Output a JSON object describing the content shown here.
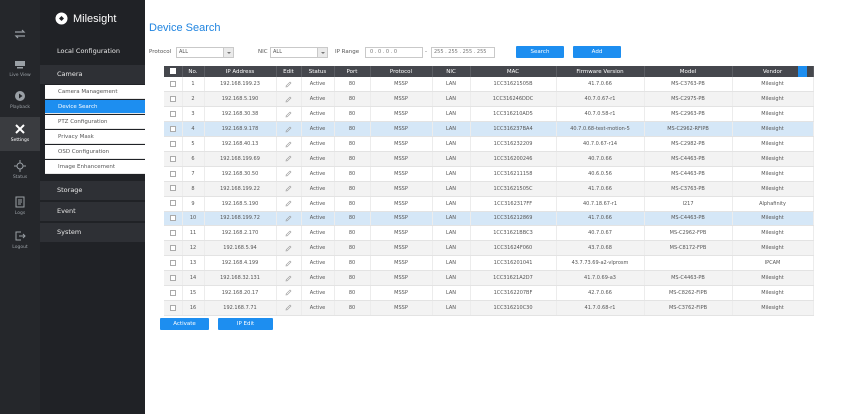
{
  "rail": [
    {
      "name": "live-view",
      "label": "Live View"
    },
    {
      "name": "playback",
      "label": "Playback"
    },
    {
      "name": "settings",
      "label": "Settings"
    },
    {
      "name": "status",
      "label": "Status"
    },
    {
      "name": "logs",
      "label": "Logs"
    },
    {
      "name": "logout",
      "label": "Logout"
    }
  ],
  "brand": "Milesight",
  "menu": {
    "local_configuration": "Local Configuration",
    "camera": "Camera",
    "sub_items": [
      "Camera Management",
      "Device Search",
      "PTZ Configuration",
      "Privacy Mask",
      "OSD Configuration",
      "Image Enhancement"
    ],
    "storage": "Storage",
    "event": "Event",
    "system": "System"
  },
  "page": {
    "title": "Device Search",
    "protocol_label": "Protocol",
    "protocol_value": "ALL",
    "nic_label": "NIC",
    "nic_value": "ALL",
    "ip_range_label": "IP Range",
    "ip_start": "0 . 0 . 0 . 0",
    "ip_end": "255 . 255 . 255 . 255",
    "search_button": "Search",
    "add_button": "Add",
    "activate_button": "Activate",
    "ip_edit_button": "IP Edit"
  },
  "table": {
    "headers": [
      "No.",
      "IP Address",
      "Edit",
      "Status",
      "Port",
      "Protocol",
      "NIC",
      "MAC",
      "Firmware Version",
      "Model",
      "Vendor"
    ],
    "rows": [
      [
        "1",
        "192.168.199.23",
        "Active",
        "80",
        "MSSP",
        "LAN",
        "1CC31621505B",
        "41.7.0.66",
        "MS-C3763-PB",
        "Milesight"
      ],
      [
        "2",
        "192.168.5.190",
        "Active",
        "80",
        "MSSP",
        "LAN",
        "1CC316246DDC",
        "40.7.0.67-r1",
        "MS-C2975-PB",
        "Milesight"
      ],
      [
        "3",
        "192.168.30.38",
        "Active",
        "80",
        "MSSP",
        "LAN",
        "1CC316210AD5",
        "40.7.0.58-r1",
        "MS-C2963-PB",
        "Milesight"
      ],
      [
        "4",
        "192.168.9.178",
        "Active",
        "80",
        "MSSP",
        "LAN",
        "1CC316237BA4",
        "40.7.0.68-test-motion-5",
        "MS-C2962-RFIPB",
        "Milesight"
      ],
      [
        "5",
        "192.168.40.13",
        "Active",
        "80",
        "MSSP",
        "LAN",
        "1CC316232209",
        "40.7.0.67-r14",
        "MS-C2982-PB",
        "Milesight"
      ],
      [
        "6",
        "192.168.199.69",
        "Active",
        "80",
        "MSSP",
        "LAN",
        "1CC316200246",
        "40.7.0.66",
        "MS-C4463-PB",
        "Milesight"
      ],
      [
        "7",
        "192.168.30.50",
        "Active",
        "80",
        "MSSP",
        "LAN",
        "1CC316211158",
        "40.6.0.56",
        "MS-C4463-PB",
        "Milesight"
      ],
      [
        "8",
        "192.168.199.22",
        "Active",
        "80",
        "MSSP",
        "LAN",
        "1CC31621505C",
        "41.7.0.66",
        "MS-C3763-PB",
        "Milesight"
      ],
      [
        "9",
        "192.168.5.190",
        "Active",
        "80",
        "MSSP",
        "LAN",
        "1CC3162317FF",
        "40.7.18.67-r1",
        "I217",
        "Alphafinity"
      ],
      [
        "10",
        "192.168.199.72",
        "Active",
        "80",
        "MSSP",
        "LAN",
        "1CC316212869",
        "41.7.0.66",
        "MS-C4463-PB",
        "Milesight"
      ],
      [
        "11",
        "192.168.2.170",
        "Active",
        "80",
        "MSSP",
        "LAN",
        "1CC31621BBC3",
        "40.7.0.67",
        "MS-C2962-FPB",
        "Milesight"
      ],
      [
        "12",
        "192.168.5.94",
        "Active",
        "80",
        "MSSP",
        "LAN",
        "1CC31624F060",
        "43.7.0.68",
        "MS-C8172-FPB",
        "Milesight"
      ],
      [
        "13",
        "192.168.4.199",
        "Active",
        "80",
        "MSSP",
        "LAN",
        "1CC316201041",
        "43.7.73.69-a2-vlprosm",
        "",
        "IPCAM"
      ],
      [
        "14",
        "192.168.32.131",
        "Active",
        "80",
        "MSSP",
        "LAN",
        "1CC31621A2D7",
        "41.7.0.69-a3",
        "MS-C4463-PB",
        "Milesight"
      ],
      [
        "15",
        "192.168.20.17",
        "Active",
        "80",
        "MSSP",
        "LAN",
        "1CC3162207BF",
        "42.7.0.66",
        "MS-C8262-FIPB",
        "Milesight"
      ],
      [
        "16",
        "192.168.7.71",
        "Active",
        "80",
        "MSSP",
        "LAN",
        "1CC316210C30",
        "41.7.0.68-r1",
        "MS-C3762-FIPB",
        "Milesight"
      ]
    ]
  },
  "colors": {
    "accent": "#1d8ef0",
    "rail_bg": "#25272b",
    "menu_bg": "#202226",
    "header_bg": "#45474d",
    "highlight_row": "#d5e7f7"
  }
}
